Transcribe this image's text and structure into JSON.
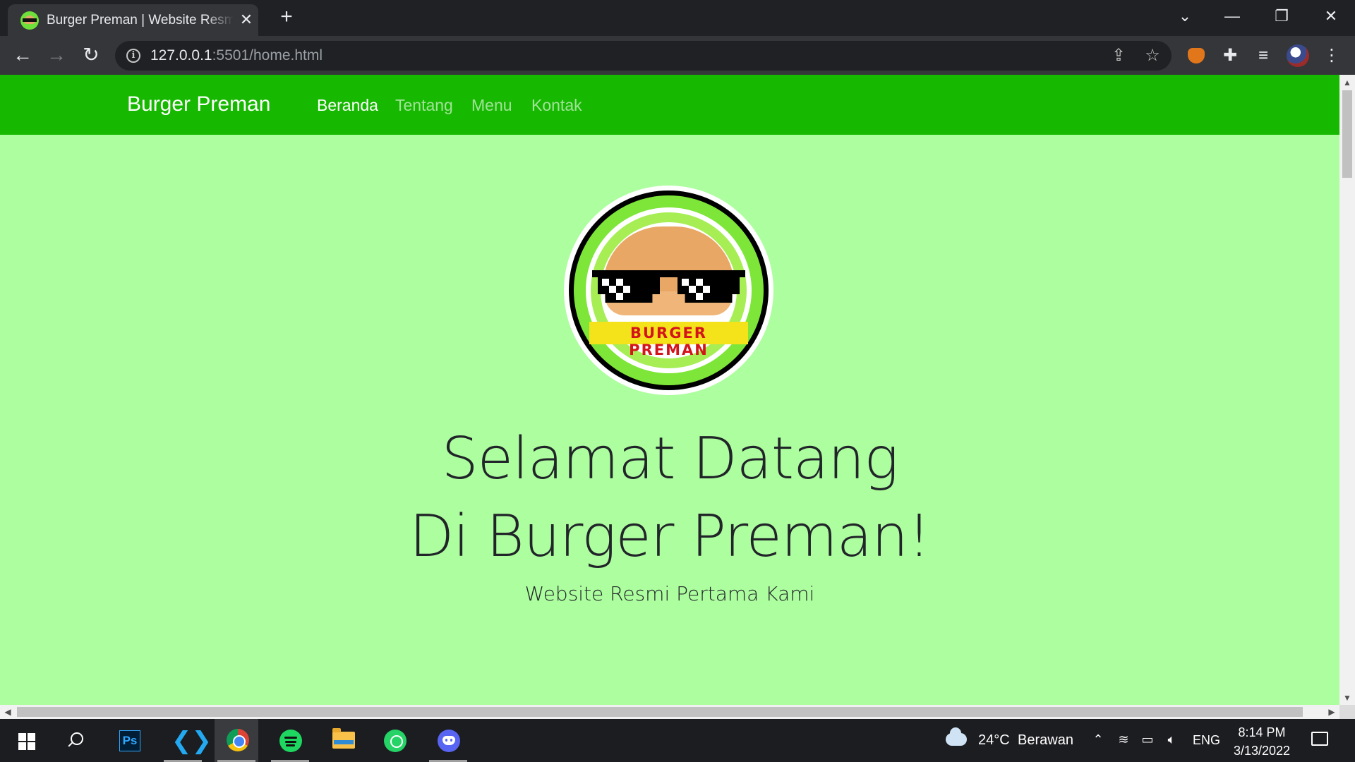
{
  "browser": {
    "tab": {
      "title": "Burger Preman | Website Resmi Pertama Kami",
      "close": "✕"
    },
    "new_tab": "+",
    "window_controls": {
      "dropdown": "⌄",
      "minimize": "—",
      "restore": "❐",
      "close": "✕"
    },
    "nav": {
      "back": "←",
      "forward": "→",
      "reload": "↻"
    },
    "url_host": "127.0.0.1",
    "url_path": ":5501/home.html",
    "omnibox_icons": [
      "info-icon",
      "share-icon",
      "bookmark-star-icon"
    ],
    "extension_icons": [
      "metamask-fox-icon",
      "puzzle-extensions-icon",
      "media-queue-icon",
      "profile-avatar",
      "kebab-menu-icon"
    ]
  },
  "site": {
    "brand": "Burger Preman",
    "nav_links": [
      {
        "label": "Beranda",
        "active": true
      },
      {
        "label": "Tentang",
        "active": false
      },
      {
        "label": "Menu",
        "active": false
      },
      {
        "label": "Kontak",
        "active": false
      }
    ],
    "logo_text": "BURGER PREMAN",
    "hero_line1": "Selamat Datang",
    "hero_line2": "Di Burger Preman!",
    "hero_subtitle": "Website Resmi Pertama Kami",
    "colors": {
      "navbar": "#16b800",
      "background": "#adfe9f",
      "text": "#212529"
    }
  },
  "taskbar": {
    "apps": [
      "windows-start-icon",
      "search-icon",
      "photoshop-icon",
      "vscode-icon",
      "chrome-icon",
      "spotify-icon",
      "file-explorer-icon",
      "whatsapp-icon",
      "discord-icon"
    ],
    "photoshop_label": "Ps",
    "weather_temp": "24°C",
    "weather_desc": "Berawan",
    "language": "ENG",
    "time": "8:14 PM",
    "date": "3/13/2022"
  }
}
